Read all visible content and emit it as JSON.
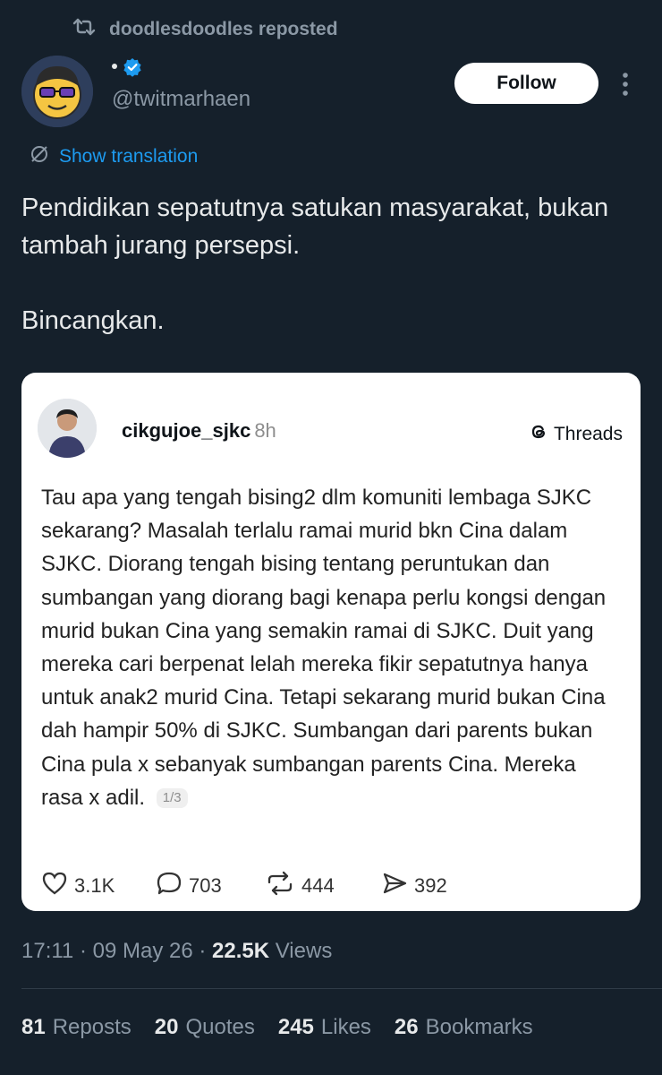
{
  "repost": {
    "text": "doodlesdoodles reposted"
  },
  "author": {
    "display_name": "·",
    "handle": "@twitmarhaen",
    "verified": true
  },
  "follow_button": {
    "label": "Follow"
  },
  "translation": {
    "label": "Show translation"
  },
  "tweet": {
    "paragraphs": [
      "Pendidikan sepatutnya satukan masyarakat, bukan tambah jurang persepsi.",
      "Bincangkan."
    ]
  },
  "embedded_post": {
    "username": "cikgujoe_sjkc",
    "time": "8h",
    "platform": "Threads",
    "text": "Tau apa yang tengah bising2 dlm komuniti lembaga SJKC sekarang? Masalah terlalu ramai murid bkn Cina dalam SJKC. Diorang tengah bising tentang peruntukan dan sumbangan yang diorang bagi kenapa perlu kongsi dengan murid bukan Cina yang semakin ramai di SJKC. Duit yang mereka cari berpenat lelah mereka fikir sepatutnya hanya untuk anak2 murid Cina. Tetapi sekarang murid bukan Cina dah hampir 50% di SJKC. Sumbangan dari parents bukan Cina pula x sebanyak sumbangan parents Cina. Mereka rasa x adil.",
    "page_badge": "1/3",
    "likes": "3.1K",
    "comments": "703",
    "reposts": "444",
    "shares": "392"
  },
  "meta": {
    "time": "17:11",
    "date": "09 May 26",
    "views_count": "22.5K",
    "views_label": "Views"
  },
  "stats": {
    "reposts_count": "81",
    "reposts_label": "Reposts",
    "quotes_count": "20",
    "quotes_label": "Quotes",
    "likes_count": "245",
    "likes_label": "Likes",
    "bookmarks_count": "26",
    "bookmarks_label": "Bookmarks"
  },
  "colors": {
    "background": "#15202b",
    "accent": "#1d9bf0",
    "muted": "#8b98a5",
    "text": "#e7e9ea"
  }
}
